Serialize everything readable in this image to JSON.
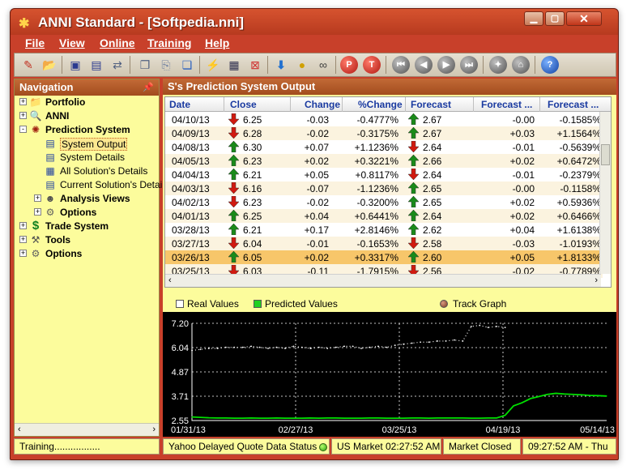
{
  "window": {
    "title": "ANNI Standard - [Softpedia.nni]"
  },
  "menu": [
    {
      "label": "File"
    },
    {
      "label": "View"
    },
    {
      "label": "Online"
    },
    {
      "label": "Training"
    },
    {
      "label": "Help"
    }
  ],
  "toolbar": {
    "buttons": [
      "new-icon",
      "open-icon",
      "save-icon",
      "save-as-icon",
      "swap-icon",
      "copy-icon",
      "open-folder-icon",
      "stack-icon",
      "wand-icon",
      "grid-icon",
      "delete-icon",
      "download-icon",
      "coins-icon",
      "binoculars-icon",
      "p-icon",
      "t-icon",
      "first-icon",
      "prev-icon",
      "next-icon",
      "last-icon",
      "network-icon",
      "home-icon",
      "help-icon"
    ],
    "p_label": "P",
    "t_label": "T",
    "help_label": "?"
  },
  "navigation": {
    "title": "Navigation",
    "items": [
      {
        "label": "Portfolio",
        "icon": "folder-icon",
        "level": 0,
        "expander": "+",
        "bold": true
      },
      {
        "label": "ANNI",
        "icon": "magnifier-icon",
        "level": 0,
        "expander": "+",
        "bold": true
      },
      {
        "label": "Prediction System",
        "icon": "prediction-icon",
        "level": 0,
        "expander": "-",
        "bold": true
      },
      {
        "label": "System Output",
        "icon": "window-icon",
        "level": 1,
        "expander": "",
        "bold": false,
        "selected": true
      },
      {
        "label": "System Details",
        "icon": "window-icon",
        "level": 1,
        "expander": "",
        "bold": false
      },
      {
        "label": "All Solution's Details",
        "icon": "grid-icon",
        "level": 1,
        "expander": "",
        "bold": false
      },
      {
        "label": "Current Solution's Details",
        "icon": "window-icon",
        "level": 1,
        "expander": "",
        "bold": false
      },
      {
        "label": "Analysis Views",
        "icon": "person-icon",
        "level": 1,
        "expander": "+",
        "bold": true
      },
      {
        "label": "Options",
        "icon": "options-icon",
        "level": 1,
        "expander": "+",
        "bold": true
      },
      {
        "label": "Trade System",
        "icon": "dollar-icon",
        "level": 0,
        "expander": "+",
        "bold": true
      },
      {
        "label": "Tools",
        "icon": "tools-icon",
        "level": 0,
        "expander": "+",
        "bold": true
      },
      {
        "label": "Options",
        "icon": "options-icon",
        "level": 0,
        "expander": "+",
        "bold": true
      }
    ]
  },
  "output": {
    "title": "S's Prediction System Output",
    "columns": [
      "Date",
      "Close",
      "Change",
      "%Change",
      "Forecast",
      "Forecast ...",
      "Forecast ..."
    ],
    "rows": [
      {
        "date": "04/10/13",
        "dir": "down",
        "close": "6.25",
        "change": "-0.03",
        "pct": "-0.4777%",
        "fdir": "up",
        "forecast": "2.67",
        "f2": "-0.00",
        "f3": "-0.1585%"
      },
      {
        "date": "04/09/13",
        "dir": "down",
        "close": "6.28",
        "change": "-0.02",
        "pct": "-0.3175%",
        "fdir": "up",
        "forecast": "2.67",
        "f2": "+0.03",
        "f3": "+1.1564%"
      },
      {
        "date": "04/08/13",
        "dir": "up",
        "close": "6.30",
        "change": "+0.07",
        "pct": "+1.1236%",
        "fdir": "down",
        "forecast": "2.64",
        "f2": "-0.01",
        "f3": "-0.5639%"
      },
      {
        "date": "04/05/13",
        "dir": "up",
        "close": "6.23",
        "change": "+0.02",
        "pct": "+0.3221%",
        "fdir": "up",
        "forecast": "2.66",
        "f2": "+0.02",
        "f3": "+0.6472%"
      },
      {
        "date": "04/04/13",
        "dir": "up",
        "close": "6.21",
        "change": "+0.05",
        "pct": "+0.8117%",
        "fdir": "down",
        "forecast": "2.64",
        "f2": "-0.01",
        "f3": "-0.2379%"
      },
      {
        "date": "04/03/13",
        "dir": "down",
        "close": "6.16",
        "change": "-0.07",
        "pct": "-1.1236%",
        "fdir": "up",
        "forecast": "2.65",
        "f2": "-0.00",
        "f3": "-0.1158%"
      },
      {
        "date": "04/02/13",
        "dir": "down",
        "close": "6.23",
        "change": "-0.02",
        "pct": "-0.3200%",
        "fdir": "up",
        "forecast": "2.65",
        "f2": "+0.02",
        "f3": "+0.5936%"
      },
      {
        "date": "04/01/13",
        "dir": "up",
        "close": "6.25",
        "change": "+0.04",
        "pct": "+0.6441%",
        "fdir": "up",
        "forecast": "2.64",
        "f2": "+0.02",
        "f3": "+0.6466%"
      },
      {
        "date": "03/28/13",
        "dir": "up",
        "close": "6.21",
        "change": "+0.17",
        "pct": "+2.8146%",
        "fdir": "up",
        "forecast": "2.62",
        "f2": "+0.04",
        "f3": "+1.6138%"
      },
      {
        "date": "03/27/13",
        "dir": "down",
        "close": "6.04",
        "change": "-0.01",
        "pct": "-0.1653%",
        "fdir": "down",
        "forecast": "2.58",
        "f2": "-0.03",
        "f3": "-1.0193%"
      },
      {
        "date": "03/26/13",
        "dir": "up",
        "close": "6.05",
        "change": "+0.02",
        "pct": "+0.3317%",
        "fdir": "up",
        "forecast": "2.60",
        "f2": "+0.05",
        "f3": "+1.8133%"
      },
      {
        "date": "03/25/13",
        "dir": "down",
        "close": "6.03",
        "change": "-0.11",
        "pct": "-1.7915%",
        "fdir": "down",
        "forecast": "2.56",
        "f2": "-0.02",
        "f3": "-0.7789%"
      }
    ],
    "selected_row": 10
  },
  "legend": {
    "real": "Real Values",
    "predicted": "Predicted Values",
    "track": "Track Graph",
    "real_color": "#ffffff",
    "predicted_color": "#00e000"
  },
  "chart_data": {
    "type": "line",
    "yticks": [
      "7.20",
      "6.04",
      "4.87",
      "3.71",
      "2.55"
    ],
    "xticks": [
      "01/31/13",
      "02/27/13",
      "03/25/13",
      "04/19/13",
      "05/14/13"
    ],
    "ylim": [
      2.55,
      7.2
    ],
    "grid": true,
    "series": [
      {
        "name": "Real Values",
        "color": "#ffffff",
        "style": "dotted",
        "x": [
          0,
          10,
          20,
          30,
          40,
          50,
          60,
          70,
          80,
          90,
          100,
          110,
          120,
          130,
          140,
          150,
          160,
          170,
          180,
          190,
          200,
          210,
          220,
          230,
          240,
          250,
          260,
          270,
          280,
          290,
          300,
          310,
          320,
          330,
          340,
          350,
          360,
          370
        ],
        "y": [
          5.9,
          5.95,
          6.0,
          6.0,
          6.05,
          6.05,
          6.05,
          6.1,
          6.05,
          6.0,
          6.05,
          6.0,
          6.1,
          6.05,
          6.0,
          6.05,
          6.0,
          6.05,
          6.1,
          6.1,
          6.0,
          6.05,
          6.1,
          6.05,
          6.15,
          6.2,
          6.25,
          6.3,
          6.3,
          6.35,
          6.35,
          6.4,
          6.35,
          7.05,
          7.1,
          7.0,
          7.05,
          7.0
        ]
      },
      {
        "name": "Predicted Values",
        "color": "#00e000",
        "style": "solid",
        "x": [
          0,
          10,
          20,
          30,
          40,
          50,
          60,
          70,
          80,
          90,
          100,
          110,
          120,
          130,
          140,
          150,
          160,
          170,
          180,
          190,
          200,
          210,
          220,
          230,
          240,
          250,
          260,
          270,
          280,
          290,
          300,
          310,
          320,
          330,
          340,
          350,
          360,
          370,
          380,
          390,
          400,
          410,
          420,
          430,
          440,
          450,
          460,
          470,
          480,
          490
        ],
        "y": [
          2.72,
          2.7,
          2.68,
          2.67,
          2.67,
          2.66,
          2.66,
          2.67,
          2.66,
          2.66,
          2.67,
          2.66,
          2.66,
          2.66,
          2.67,
          2.66,
          2.67,
          2.67,
          2.66,
          2.66,
          2.66,
          2.67,
          2.67,
          2.66,
          2.66,
          2.66,
          2.67,
          2.67,
          2.66,
          2.67,
          2.67,
          2.67,
          2.67,
          2.66,
          2.66,
          2.67,
          2.67,
          2.8,
          3.25,
          3.4,
          3.6,
          3.7,
          3.8,
          3.85,
          3.82,
          3.8,
          3.78,
          3.75,
          3.74,
          3.72
        ]
      }
    ]
  },
  "status": {
    "training": "Training.................",
    "yahoo": "Yahoo Delayed Quote Data Status",
    "market_time": "US Market 02:27:52 AM",
    "market_state": "Market Closed",
    "local_time": "09:27:52 AM - Thu"
  }
}
